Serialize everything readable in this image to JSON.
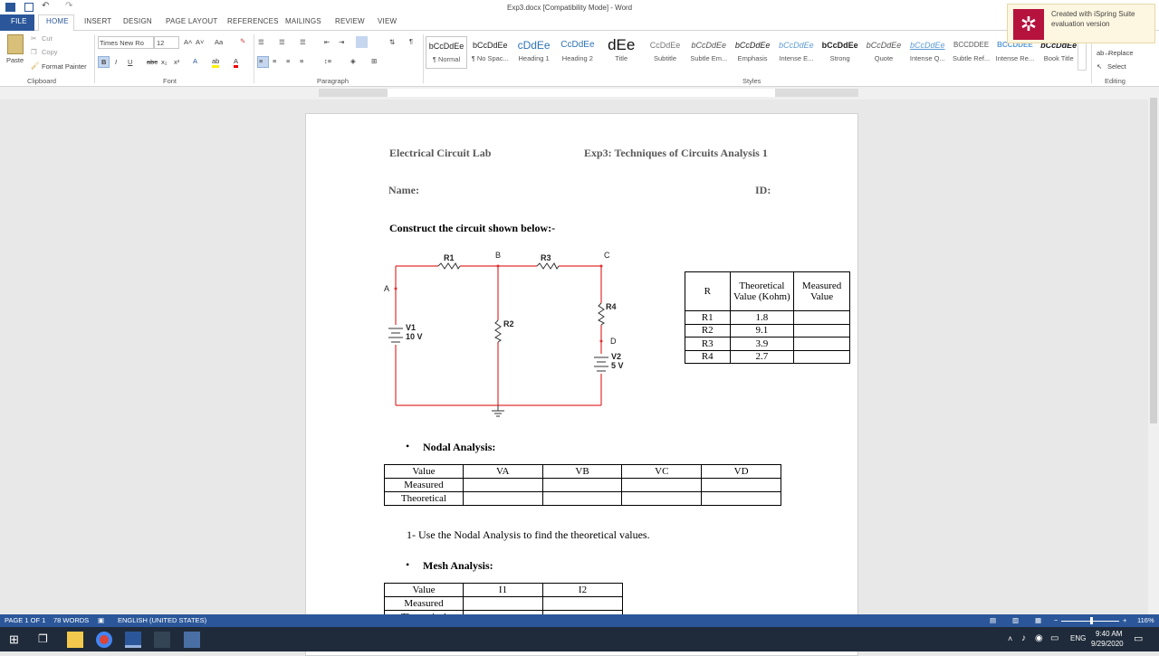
{
  "window": {
    "title": "Exp3.docx [Compatibility Mode] - Word"
  },
  "ribbon_tabs": [
    "FILE",
    "HOME",
    "INSERT",
    "DESIGN",
    "PAGE LAYOUT",
    "REFERENCES",
    "MAILINGS",
    "REVIEW",
    "VIEW"
  ],
  "clipboard": {
    "paste": "Paste",
    "cut": "Cut",
    "copy": "Copy",
    "format_painter": "Format Painter",
    "label": "Clipboard"
  },
  "font": {
    "name": "Times New Ro",
    "size": "12",
    "label": "Font"
  },
  "paragraph": {
    "label": "Paragraph"
  },
  "styles": {
    "label": "Styles",
    "items": [
      {
        "sample": "bCcDdEe",
        "name": "¶ Normal"
      },
      {
        "sample": "bCcDdEe",
        "name": "¶ No Spac..."
      },
      {
        "sample": "cDdEe",
        "name": "Heading 1"
      },
      {
        "sample": "CcDdEe",
        "name": "Heading 2"
      },
      {
        "sample": "dEe",
        "name": "Title"
      },
      {
        "sample": "CcDdEe",
        "name": "Subtitle"
      },
      {
        "sample": "bCcDdEe",
        "name": "Subtle Em..."
      },
      {
        "sample": "bCcDdEe",
        "name": "Emphasis"
      },
      {
        "sample": "bCcDdEe",
        "name": "Intense E..."
      },
      {
        "sample": "bCcDdEe",
        "name": "Strong"
      },
      {
        "sample": "bCcDdEe",
        "name": "Quote"
      },
      {
        "sample": "bCcDdEe",
        "name": "Intense Q..."
      },
      {
        "sample": "BCCDDEE",
        "name": "Subtle Ref..."
      },
      {
        "sample": "BCCDDEE",
        "name": "Intense Re..."
      },
      {
        "sample": "bCcDdEe",
        "name": "Book Title"
      }
    ]
  },
  "editing": {
    "replace": "Replace",
    "select": "Select",
    "label": "Editing"
  },
  "ispring": {
    "line1": "Created with iSpring Suite",
    "line2": "evaluation version"
  },
  "document": {
    "header_left": "Electrical Circuit Lab",
    "header_right": "Exp3: Techniques of Circuits Analysis 1",
    "name_label": "Name:",
    "id_label": "ID:",
    "instruction": "Construct the circuit shown below:-",
    "circuit": {
      "node_a": "A",
      "node_b": "B",
      "node_c": "C",
      "node_d": "D",
      "r1": "R1",
      "r2": "R2",
      "r3": "R3",
      "r4": "R4",
      "v1": "V1",
      "v1_val": "10 V",
      "v2": "V2",
      "v2_val": "5 V"
    },
    "r_table": {
      "headers": [
        "R",
        "Theoretical Value (Kohm)",
        "Measured Value"
      ],
      "rows": [
        [
          "R1",
          "1.8",
          ""
        ],
        [
          "R2",
          "9.1",
          ""
        ],
        [
          "R3",
          "3.9",
          ""
        ],
        [
          "R4",
          "2.7",
          ""
        ]
      ]
    },
    "nodal_heading": "Nodal Analysis:",
    "nodal_table": {
      "headers": [
        "Value",
        "VA",
        "VB",
        "VC",
        "VD"
      ],
      "rows": [
        [
          "Measured",
          "",
          "",
          "",
          ""
        ],
        [
          "Theoretical",
          "",
          "",
          "",
          ""
        ]
      ]
    },
    "step1": "1-   Use the Nodal Analysis to find the theoretical values.",
    "mesh_heading": "Mesh Analysis:",
    "mesh_table": {
      "headers": [
        "Value",
        "I1",
        "I2"
      ],
      "rows": [
        [
          "Measured",
          "",
          ""
        ],
        [
          "Theoretical",
          "",
          ""
        ]
      ]
    }
  },
  "status": {
    "page": "PAGE 1 OF 1",
    "words": "78 WORDS",
    "language": "ENGLISH (UNITED STATES)",
    "zoom": "116%"
  },
  "taskbar": {
    "lang": "ENG",
    "time": "9:40 AM",
    "date": "9/29/2020"
  },
  "colors": {
    "accent": "#2b579a",
    "circuit_wire": "#e03030"
  }
}
